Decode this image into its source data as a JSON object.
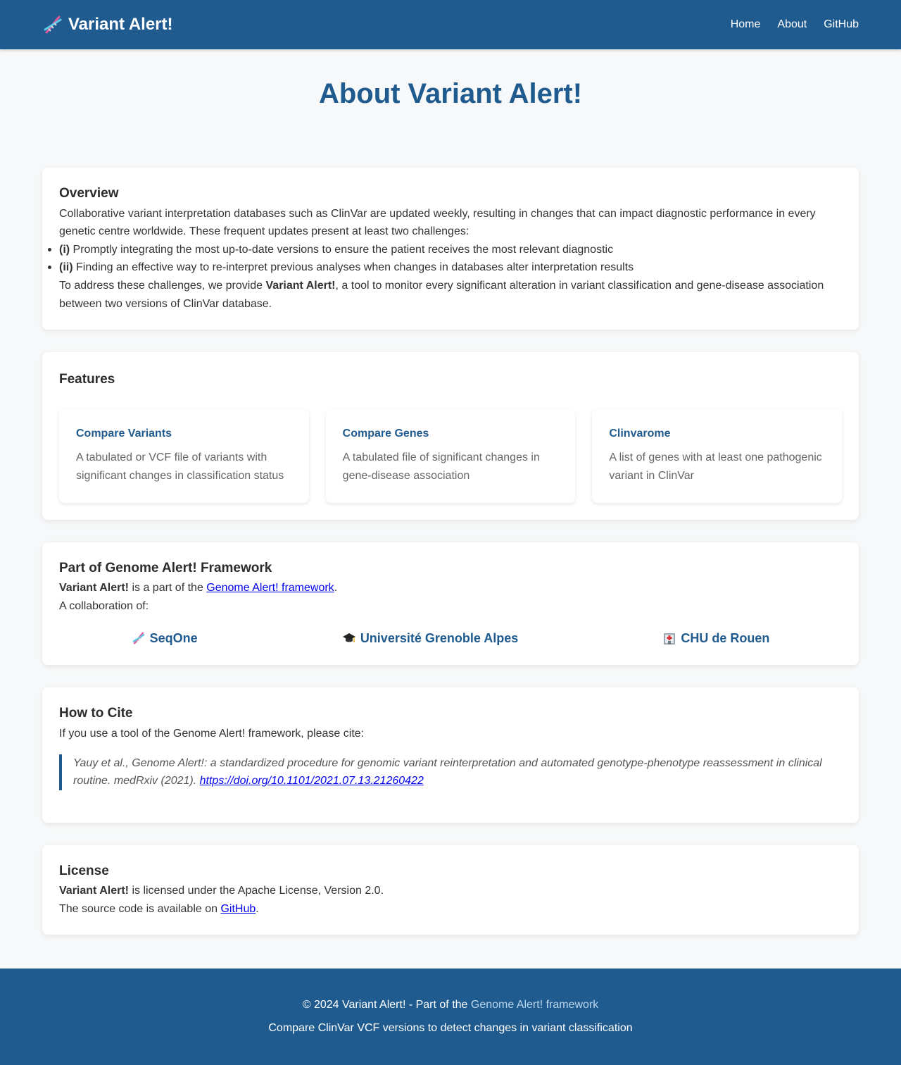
{
  "header": {
    "brand": "Variant Alert!",
    "nav": [
      "Home",
      "About",
      "GitHub"
    ]
  },
  "page": {
    "title": "About Variant Alert!"
  },
  "overview": {
    "heading": "Overview",
    "intro": "Collaborative variant interpretation databases such as ClinVar are updated weekly, resulting in changes that can impact diagnostic performance in every genetic centre worldwide. These frequent updates present at least two challenges:",
    "items": [
      {
        "tag": "(i)",
        "text": " Promptly integrating the most up-to-date versions to ensure the patient receives the most relevant diagnostic"
      },
      {
        "tag": "(ii)",
        "text": " Finding an effective way to re-interpret previous analyses when changes in databases alter interpretation results"
      }
    ],
    "outro_before": "To address these challenges, we provide ",
    "outro_bold": "Variant Alert!",
    "outro_after": ", a tool to monitor every significant alteration in variant classification and gene-disease association between two versions of ClinVar database."
  },
  "features": {
    "heading": "Features",
    "items": [
      {
        "title": "Compare Variants",
        "desc": "A tabulated or VCF file of variants with significant changes in classification status"
      },
      {
        "title": "Compare Genes",
        "desc": "A tabulated file of significant changes in gene-disease association"
      },
      {
        "title": "Clinvarome",
        "desc": "A list of genes with at least one pathogenic variant in ClinVar"
      }
    ]
  },
  "framework": {
    "heading": "Part of Genome Alert! Framework",
    "line_bold": "Variant Alert!",
    "line_mid": " is a part of the ",
    "line_link": "Genome Alert! framework",
    "line_end": ".",
    "collab_label": "A collaboration of:",
    "partners": [
      {
        "name": "SeqOne",
        "icon": "dna-icon"
      },
      {
        "name": "Université Grenoble Alpes",
        "icon": "graduation-cap-icon"
      },
      {
        "name": "CHU de Rouen",
        "icon": "hospital-icon"
      }
    ]
  },
  "cite": {
    "heading": "How to Cite",
    "intro": "If you use a tool of the Genome Alert! framework, please cite:",
    "quote": "Yauy et al., Genome Alert!: a standardized procedure for genomic variant reinterpretation and automated genotype-phenotype reassessment in clinical routine. medRxiv (2021). ",
    "doi": "https://doi.org/10.1101/2021.07.13.21260422"
  },
  "license": {
    "heading": "License",
    "line1_bold": "Variant Alert!",
    "line1_rest": " is licensed under the Apache License, Version 2.0.",
    "line2_before": "The source code is available on ",
    "line2_link": "GitHub",
    "line2_after": "."
  },
  "footer": {
    "line1_before": "© 2024 Variant Alert! - Part of the ",
    "line1_link": "Genome Alert! framework",
    "line2": "Compare ClinVar VCF versions to detect changes in variant classification"
  },
  "colors": {
    "primary": "#1f5b8e",
    "background": "#f7f8f9",
    "card": "#ffffff"
  }
}
